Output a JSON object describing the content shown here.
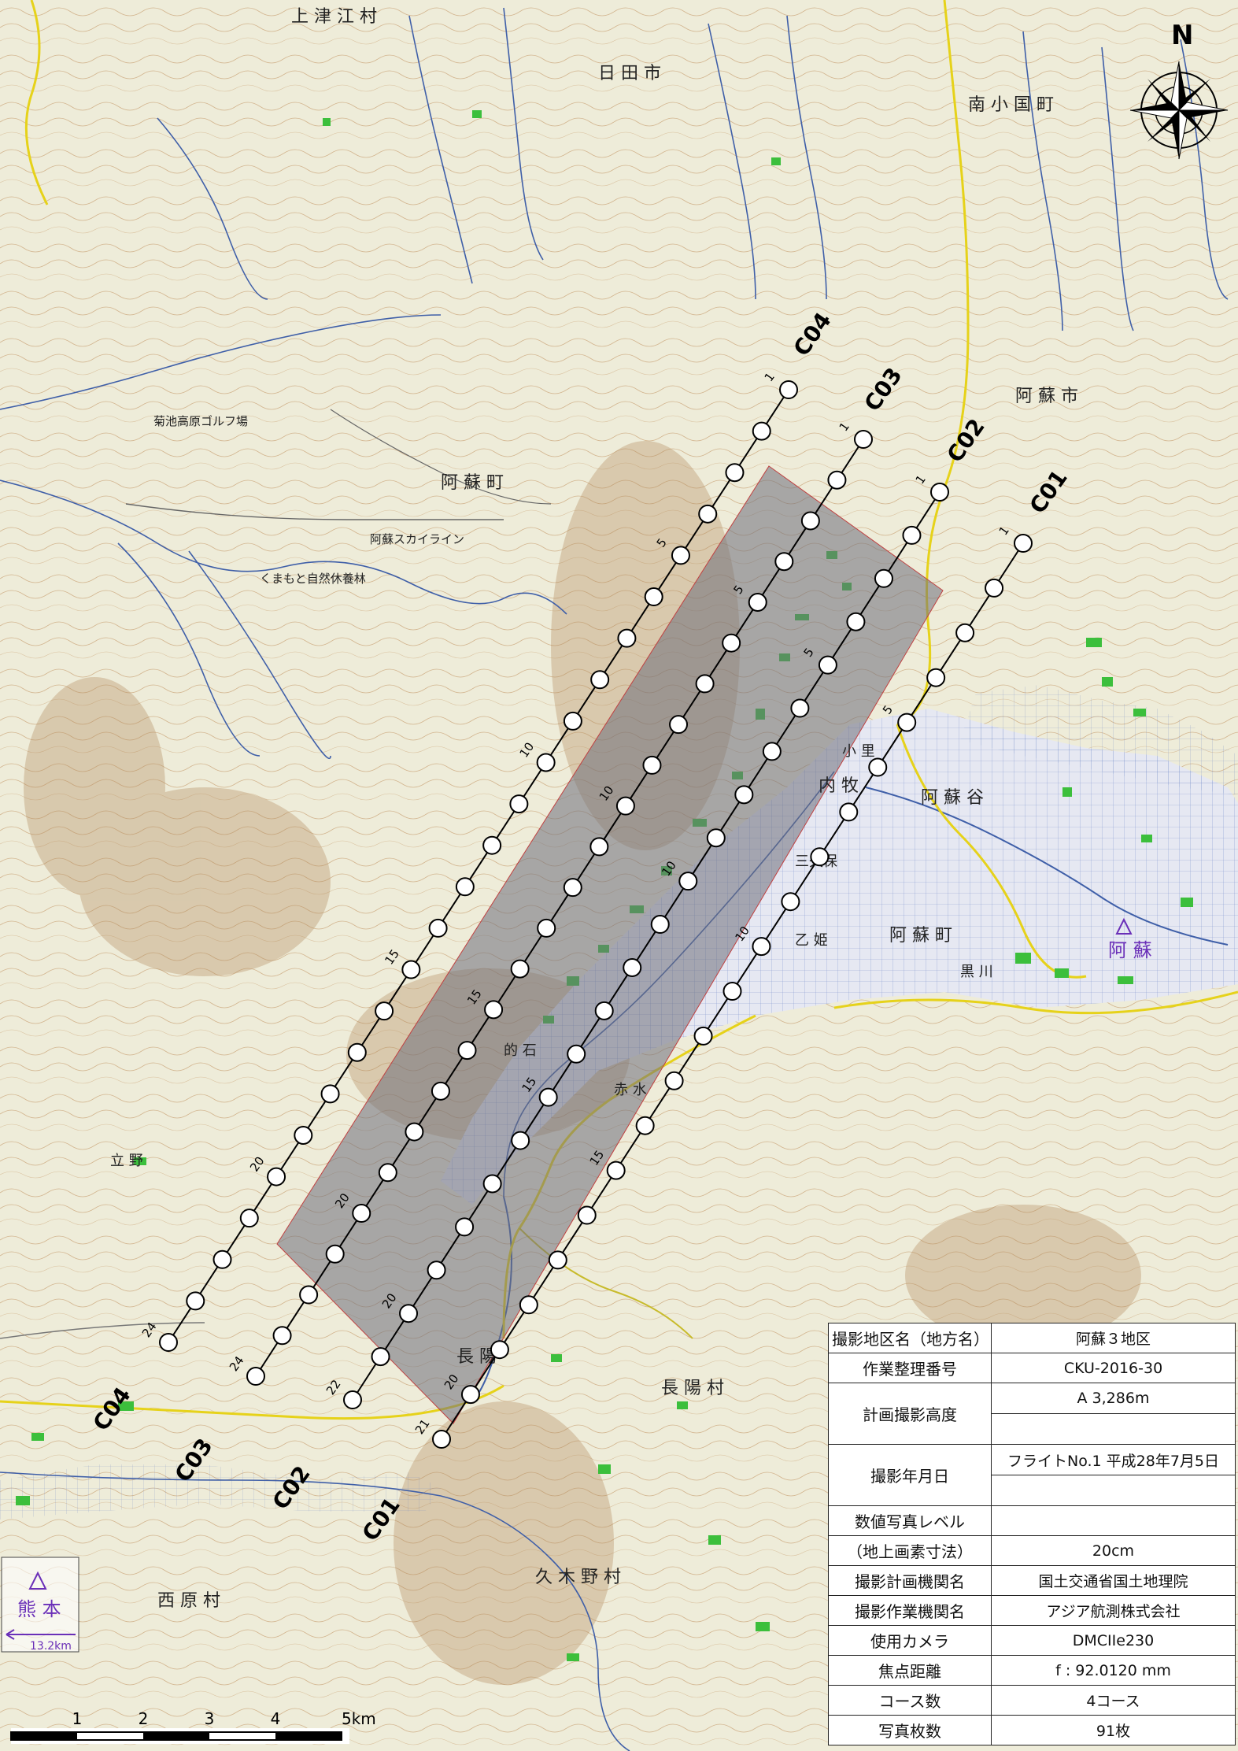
{
  "north_label": "N",
  "courses": [
    {
      "id": "C04",
      "photos": 24,
      "marks": [
        {
          "n": 1,
          "label": "1"
        },
        {
          "n": 5,
          "label": "5"
        },
        {
          "n": 10,
          "label": "10"
        },
        {
          "n": 15,
          "label": "15"
        },
        {
          "n": 20,
          "label": "20"
        },
        {
          "n": 24,
          "label": "24"
        }
      ]
    },
    {
      "id": "C03",
      "photos": 24,
      "marks": [
        {
          "n": 1,
          "label": "1"
        },
        {
          "n": 5,
          "label": "5"
        },
        {
          "n": 10,
          "label": "10"
        },
        {
          "n": 15,
          "label": "15"
        },
        {
          "n": 20,
          "label": "20"
        },
        {
          "n": 24,
          "label": "24"
        }
      ]
    },
    {
      "id": "C02",
      "photos": 22,
      "marks": [
        {
          "n": 1,
          "label": "1"
        },
        {
          "n": 5,
          "label": "5"
        },
        {
          "n": 10,
          "label": "10"
        },
        {
          "n": 15,
          "label": "15"
        },
        {
          "n": 20,
          "label": "20"
        },
        {
          "n": 22,
          "label": "22"
        }
      ]
    },
    {
      "id": "C01",
      "photos": 21,
      "marks": [
        {
          "n": 1,
          "label": "1"
        },
        {
          "n": 5,
          "label": "5"
        },
        {
          "n": 10,
          "label": "10"
        },
        {
          "n": 15,
          "label": "15"
        },
        {
          "n": 20,
          "label": "20"
        },
        {
          "n": 21,
          "label": "21"
        }
      ]
    }
  ],
  "place_labels": {
    "kamitsue": "上 津 江 村",
    "hita": "日 田 市",
    "minami_oguni": "南 小 国 町",
    "aso_city": "阿 蘇 市",
    "aso_town_n": "阿 蘇 町",
    "aso_town_c": "阿 蘇 町",
    "aso_town_w": "阿 蘇 町",
    "aso_dani": "阿 蘇 谷",
    "choyo": "長 陽 村",
    "kugino": "久 木 野 村",
    "nishihara": "西 原 村",
    "choyo2": "長 陽",
    "uchinomaki": "内 牧",
    "kikuchi_golf": "菊池高原ゴルフ場",
    "aso_skyline": "阿蘇スカイライン",
    "kumamoto_forest": "くまもと自然休養林",
    "tateno": "立 野",
    "mitsukubo": "三久保",
    "kurokawa": "黒 川",
    "matoishi": "的 石",
    "akamizu": "赤 水",
    "aso_station": "阿 蘇",
    "kumamoto": "熊 本",
    "kumamoto_dist": "13.2km",
    "ooto": "乙 姫",
    "kono": "小 里"
  },
  "scale_bar": {
    "labels": [
      "1",
      "2",
      "3",
      "4",
      "5km"
    ]
  },
  "info_table": [
    {
      "label": "撮影地区名（地方名）",
      "value": "阿蘇３地区"
    },
    {
      "label": "作業整理番号",
      "value": "CKU-2016-30"
    },
    {
      "label": "計画撮影高度",
      "value": "A 3,286m",
      "value2": ""
    },
    {
      "label": "撮影年月日",
      "value": "フライトNo.1 平成28年7月5日",
      "value2": ""
    },
    {
      "label": "数値写真レベル",
      "value": ""
    },
    {
      "label": "（地上画素寸法）",
      "value": "20cm"
    },
    {
      "label": "撮影計画機関名",
      "value": "国土交通省国土地理院"
    },
    {
      "label": "撮影作業機関名",
      "value": "アジア航測株式会社"
    },
    {
      "label": "使用カメラ",
      "value": "DMCIIe230"
    },
    {
      "label": "焦点距離",
      "value": "f : 92.0120 mm"
    },
    {
      "label": "コース数",
      "value": "4コース"
    },
    {
      "label": "写真枚数",
      "value": "91枚"
    }
  ],
  "colors": {
    "map_bg": "#efeede",
    "water": "#3f5fa8",
    "contour": "#c8a67a",
    "road_yellow": "#e6d21a",
    "forest": "#3cbf3c",
    "flight_line": "#000000",
    "area": "#6e6e7a",
    "station": "#6a2fb8"
  }
}
